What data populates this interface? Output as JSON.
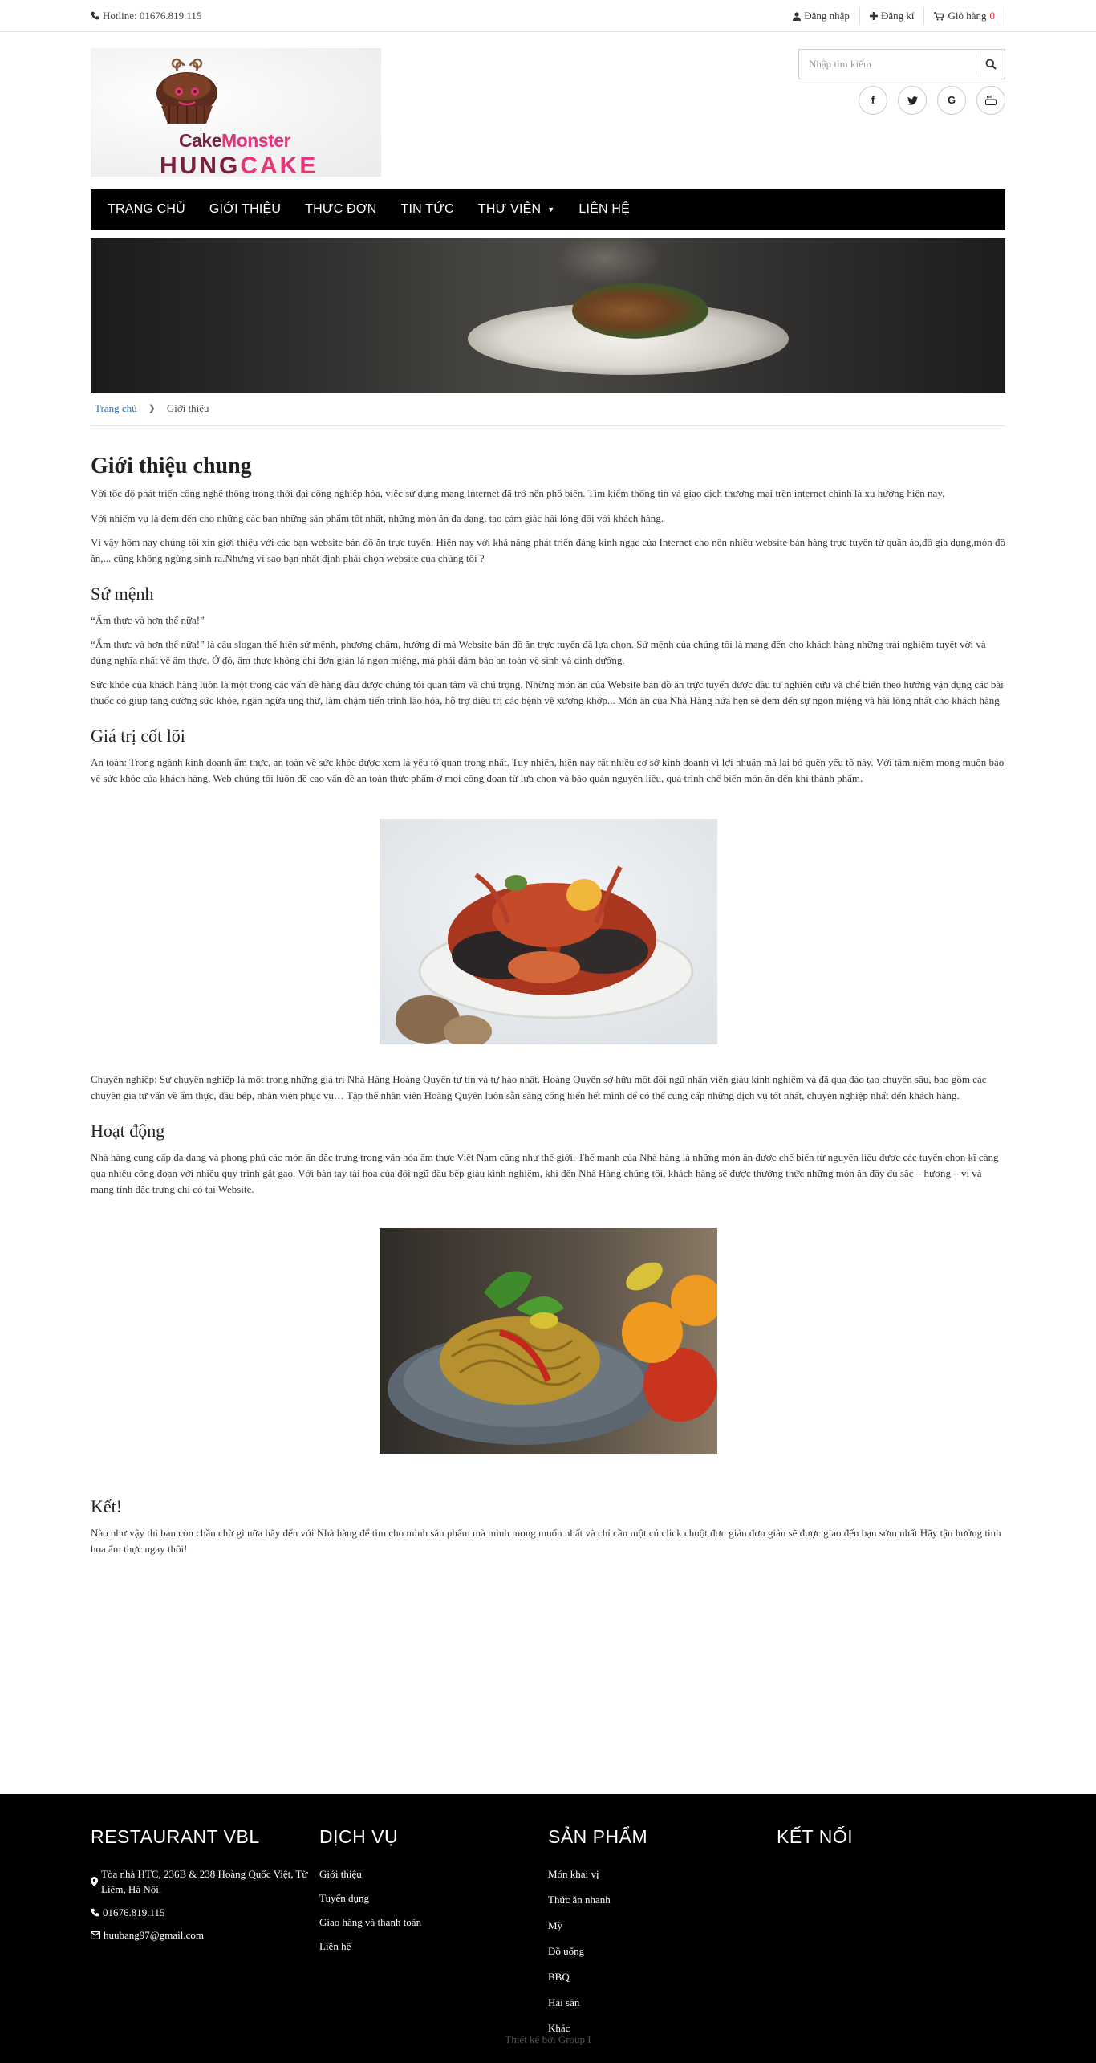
{
  "topbar": {
    "hotline": "Hotline: 01676.819.115",
    "login": "Đăng nhập",
    "register": "Đăng kí",
    "cart_label": "Giỏ hàng",
    "cart_count": "0"
  },
  "logo": {
    "line1_a": "Cake",
    "line1_b": "Monster",
    "line2_a": "HUNG",
    "line2_b": "CAKE"
  },
  "search": {
    "placeholder": "Nhập tìm kiếm"
  },
  "social": [
    "facebook-icon",
    "twitter-icon",
    "google-icon",
    "youtube-icon"
  ],
  "nav": {
    "items": [
      {
        "label": "TRANG CHỦ"
      },
      {
        "label": "GIỚI THIỆU"
      },
      {
        "label": "THỰC ĐƠN"
      },
      {
        "label": "TIN TỨC"
      },
      {
        "label": "THƯ VIỆN"
      },
      {
        "label": "LIÊN HỆ"
      }
    ]
  },
  "breadcrumb": {
    "home": "Trang chủ",
    "current": "Giới thiệu"
  },
  "content": {
    "title": "Giới thiệu chung",
    "intro_p1": "Với tốc độ phát triển công nghệ thông trong thời đại công nghiệp hóa, việc sử dụng mạng Internet đã trở nên phổ biến. Tìm kiếm thông tin và giao dịch thương mại trên internet chính là xu hướng hiện nay.",
    "intro_p2": "Với nhiệm vụ là đem đến cho những các bạn những sản phẩm tốt nhất, những món ăn đa dạng, tạo cảm giác hài lòng đối với khách hàng.",
    "intro_p3": "Vì vậy hôm nay chúng tôi xin giới thiệu với các bạn website bán đồ ăn trực tuyến. Hiện nay với khả năng phát triển đáng kinh ngạc của Internet cho nên nhiều website bán hàng trực tuyến từ quần áo,đồ gia dụng,món đồ ăn,... cũng không ngừng sinh ra.Nhưng vì sao bạn nhất định phải chọn website của chúng tôi ?",
    "mission_title": "Sứ mệnh",
    "mission_p1": "“Ẩm thực và hơn thế nữa!”",
    "mission_p2": "“Ẩm thực và hơn thế nữa!” là câu slogan thể hiện sứ mệnh, phương châm, hướng đi mà Website bán đồ ăn trực tuyến đã lựa chọn. Sứ mệnh của chúng tôi là mang đến cho khách hàng những trải nghiệm tuyệt vời và đúng nghĩa nhất về ẩm thực. Ở đó, ẩm thực không chỉ đơn giản là ngon miệng, mà phải đảm bảo an toàn vệ sinh và dinh dưỡng.",
    "mission_p3": "Sức khỏe của khách hàng luôn là một trong các vấn đề hàng đầu được chúng tôi quan tâm và chú trọng. Những món ăn của Website bán đồ ăn trực tuyến được đầu tư nghiên cứu và chế biến theo hướng vận dụng các bài thuốc có giúp tăng cường sức khỏe, ngăn ngừa ung thư, làm chậm tiến trình lão hóa, hỗ trợ điều trị các bệnh về xương khớp... Món ăn của Nhà Hàng hứa hẹn sẽ đem đến sự ngon miệng và hài lòng nhất cho khách hàng",
    "values_title": "Giá trị cốt lõi",
    "values_p1": "An toàn: Trong ngành kinh doanh ẩm thực, an toàn về sức khỏe được xem là yếu tố quan trọng nhất. Tuy nhiên, hiện nay rất nhiều cơ sở kinh doanh vì lợi nhuận mà lại bỏ quên yếu tố này. Với tâm niệm mong muốn bảo vệ sức khỏe của khách hàng, Web chúng tôi luôn đề cao vấn đề an toàn thực phẩm ở mọi công đoạn từ lựa chọn và bảo quản nguyên liệu, quá trình chế biến món ăn đến khi thành phẩm.",
    "values_p2": "Chuyên nghiệp: Sự chuyên nghiệp là một trong những giá trị Nhà Hàng Hoàng Quyên tự tin và tự hào nhất. Hoàng Quyên sở hữu một đội ngũ nhân viên giàu kinh nghiệm và đã qua đào tạo chuyên sâu, bao gồm các chuyên gia tư vấn về ẩm thực, đầu bếp, nhân viên phục vụ… Tập thể nhân viên Hoàng Quyên luôn sẵn sàng cống hiến hết mình để có thể cung cấp những dịch vụ tốt nhất, chuyên nghiệp nhất đến khách hàng.",
    "activity_title": "Hoạt động",
    "activity_p1": "Nhà hàng cung cấp đa dạng và phong phú các món ăn đặc trưng trong văn hóa ẩm thực Việt Nam cũng như thế giới. Thế mạnh của Nhà hàng là những món ăn được chế biến từ nguyên liệu được các tuyển chọn kĩ càng qua nhiều công đoạn với nhiều quy trình gắt gao. Với bàn tay tài hoa của đội ngũ đầu bếp giàu kinh nghiệm, khi đến Nhà Hàng chúng tôi, khách hàng sẽ được thưởng thức những món ăn đầy đủ sắc – hương – vị và mang tính đặc trưng chỉ có tại Website.",
    "end_title": "Kết!",
    "end_p1": "Nào như vậy thì bạn còn chần chừ gì nữa hãy đến với Nhà hàng để tìm cho mình sản phẩm mà mình mong muốn nhất và chỉ cần một cú click chuột đơn giản đơn giản sẽ được giao đến bạn sớm nhất.Hãy tận hưởng tinh hoa ẩm thực ngay thôi!"
  },
  "footer": {
    "col1_title": "RESTAURANT VBL",
    "address": "Tòa nhà HTC, 236B & 238 Hoàng Quốc Việt, Từ Liêm, Hà Nội.",
    "phone": "01676.819.115",
    "email": "huubang97@gmail.com",
    "col2_title": "DỊCH VỤ",
    "services": [
      "Giới thiệu",
      "Tuyển dụng",
      "Giao hàng và thanh toán",
      "Liên hệ"
    ],
    "col3_title": "SẢN PHẨM",
    "products": [
      "Món khai vị",
      "Thức ăn nhanh",
      "Mỳ",
      "Đồ uống",
      "BBQ",
      "Hải sản",
      "Khác"
    ],
    "col4_title": "KẾT NỐI",
    "copyright": "Thiết kế bởi Group I"
  }
}
